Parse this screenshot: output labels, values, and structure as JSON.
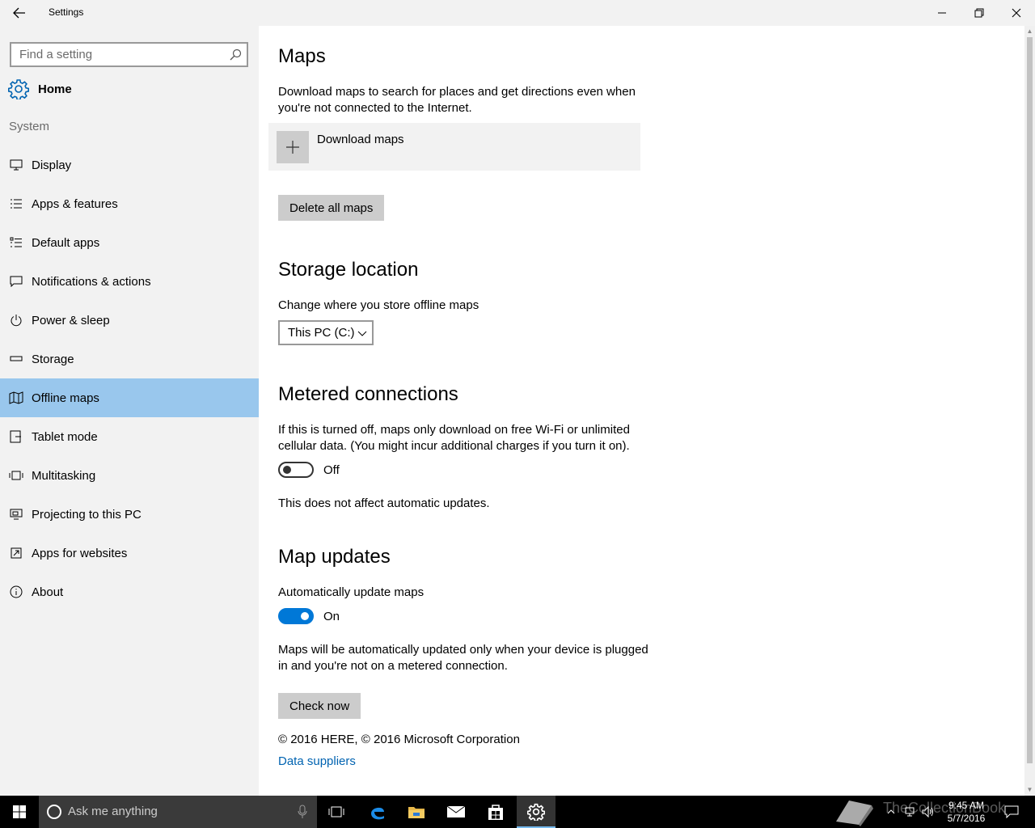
{
  "window": {
    "title": "Settings",
    "back_icon": "back-arrow-icon",
    "controls": [
      "minimize-icon",
      "restore-icon",
      "close-icon"
    ]
  },
  "sidebar": {
    "search_placeholder": "Find a setting",
    "home_label": "Home",
    "group_label": "System",
    "items": [
      {
        "label": "Display",
        "icon": "display-icon"
      },
      {
        "label": "Apps & features",
        "icon": "apps-features-icon"
      },
      {
        "label": "Default apps",
        "icon": "default-apps-icon"
      },
      {
        "label": "Notifications & actions",
        "icon": "notifications-icon"
      },
      {
        "label": "Power & sleep",
        "icon": "power-icon"
      },
      {
        "label": "Storage",
        "icon": "storage-icon"
      },
      {
        "label": "Offline maps",
        "icon": "map-icon",
        "active": true
      },
      {
        "label": "Tablet mode",
        "icon": "tablet-icon"
      },
      {
        "label": "Multitasking",
        "icon": "multitasking-icon"
      },
      {
        "label": "Projecting to this PC",
        "icon": "projecting-icon"
      },
      {
        "label": "Apps for websites",
        "icon": "apps-websites-icon"
      },
      {
        "label": "About",
        "icon": "info-icon"
      }
    ]
  },
  "main": {
    "maps": {
      "heading": "Maps",
      "description": "Download maps to search for places and get directions even when you're not connected to the Internet.",
      "download_label": "Download maps",
      "delete_label": "Delete all maps"
    },
    "storage": {
      "heading": "Storage location",
      "description": "Change where you store offline maps",
      "selected": "This PC (C:)"
    },
    "metered": {
      "heading": "Metered connections",
      "description": "If this is turned off, maps only download on free Wi-Fi or unlimited cellular data. (You might incur additional charges if you turn it on).",
      "toggle_state": "Off",
      "note": "This does not affect automatic updates."
    },
    "updates": {
      "heading": "Map updates",
      "label": "Automatically update maps",
      "toggle_state": "On",
      "note": "Maps will be automatically updated only when your device is plugged in and you're not on a metered connection.",
      "check_label": "Check now"
    },
    "copyright": "© 2016 HERE, © 2016 Microsoft Corporation",
    "data_suppliers": "Data suppliers"
  },
  "taskbar": {
    "search_placeholder": "Ask me anything",
    "time": "9:45 AM",
    "date": "5/7/2016",
    "watermark": "TheCollectionBook",
    "accent": "#0078d7"
  }
}
